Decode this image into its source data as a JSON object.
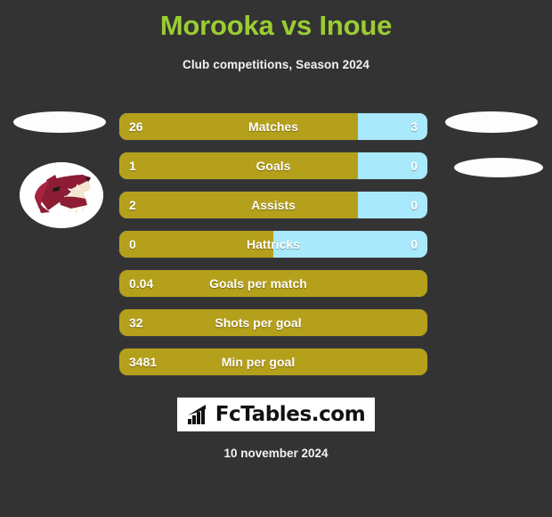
{
  "header": {
    "title": "Morooka vs Inoue",
    "subtitle": "Club competitions, Season 2024",
    "title_color": "#9ACD32"
  },
  "theme": {
    "background": "#333333",
    "home_bar_color": "#B5A01B",
    "away_bar_color": "#A8E9FB",
    "text_color": "#FFFFFF",
    "crest_color": "#8C1D35"
  },
  "teams": {
    "home_name": "Morooka",
    "away_name": "Inoue",
    "home_crest_icon": "coyote-head-crest",
    "away_crest_icon": "blank-crest-placeholder"
  },
  "chart_data": {
    "type": "bar",
    "title": "Morooka vs Inoue",
    "subtitle": "Club competitions, Season 2024",
    "orientation": "horizontal-split",
    "categories": [
      "Matches",
      "Goals",
      "Assists",
      "Hattricks",
      "Goals per match",
      "Shots per goal",
      "Min per goal"
    ],
    "series": [
      {
        "name": "Morooka",
        "values": [
          "26",
          "1",
          "2",
          "0",
          "0.04",
          "32",
          "3481"
        ]
      },
      {
        "name": "Inoue",
        "values": [
          "3",
          "0",
          "0",
          "0",
          null,
          null,
          null
        ]
      }
    ],
    "home_fill_percent": [
      77.5,
      77.5,
      77.5,
      50,
      100,
      100,
      100
    ],
    "legend": [
      "Morooka",
      "Inoue"
    ],
    "grid": false,
    "xlabel": "",
    "ylabel": ""
  },
  "rows": [
    {
      "label": "Matches",
      "home": "26",
      "away": "3",
      "home_pct": 77.5,
      "split": true
    },
    {
      "label": "Goals",
      "home": "1",
      "away": "0",
      "home_pct": 77.5,
      "split": true
    },
    {
      "label": "Assists",
      "home": "2",
      "away": "0",
      "home_pct": 77.5,
      "split": true
    },
    {
      "label": "Hattricks",
      "home": "0",
      "away": "0",
      "home_pct": 50,
      "split": true
    },
    {
      "label": "Goals per match",
      "home": "0.04",
      "away": "",
      "home_pct": 100,
      "split": false
    },
    {
      "label": "Shots per goal",
      "home": "32",
      "away": "",
      "home_pct": 100,
      "split": false
    },
    {
      "label": "Min per goal",
      "home": "3481",
      "away": "",
      "home_pct": 100,
      "split": false
    }
  ],
  "footer": {
    "brand_name": "FcTables.com",
    "brand_icon": "bar-chart-trend-icon",
    "date": "10 november 2024"
  }
}
